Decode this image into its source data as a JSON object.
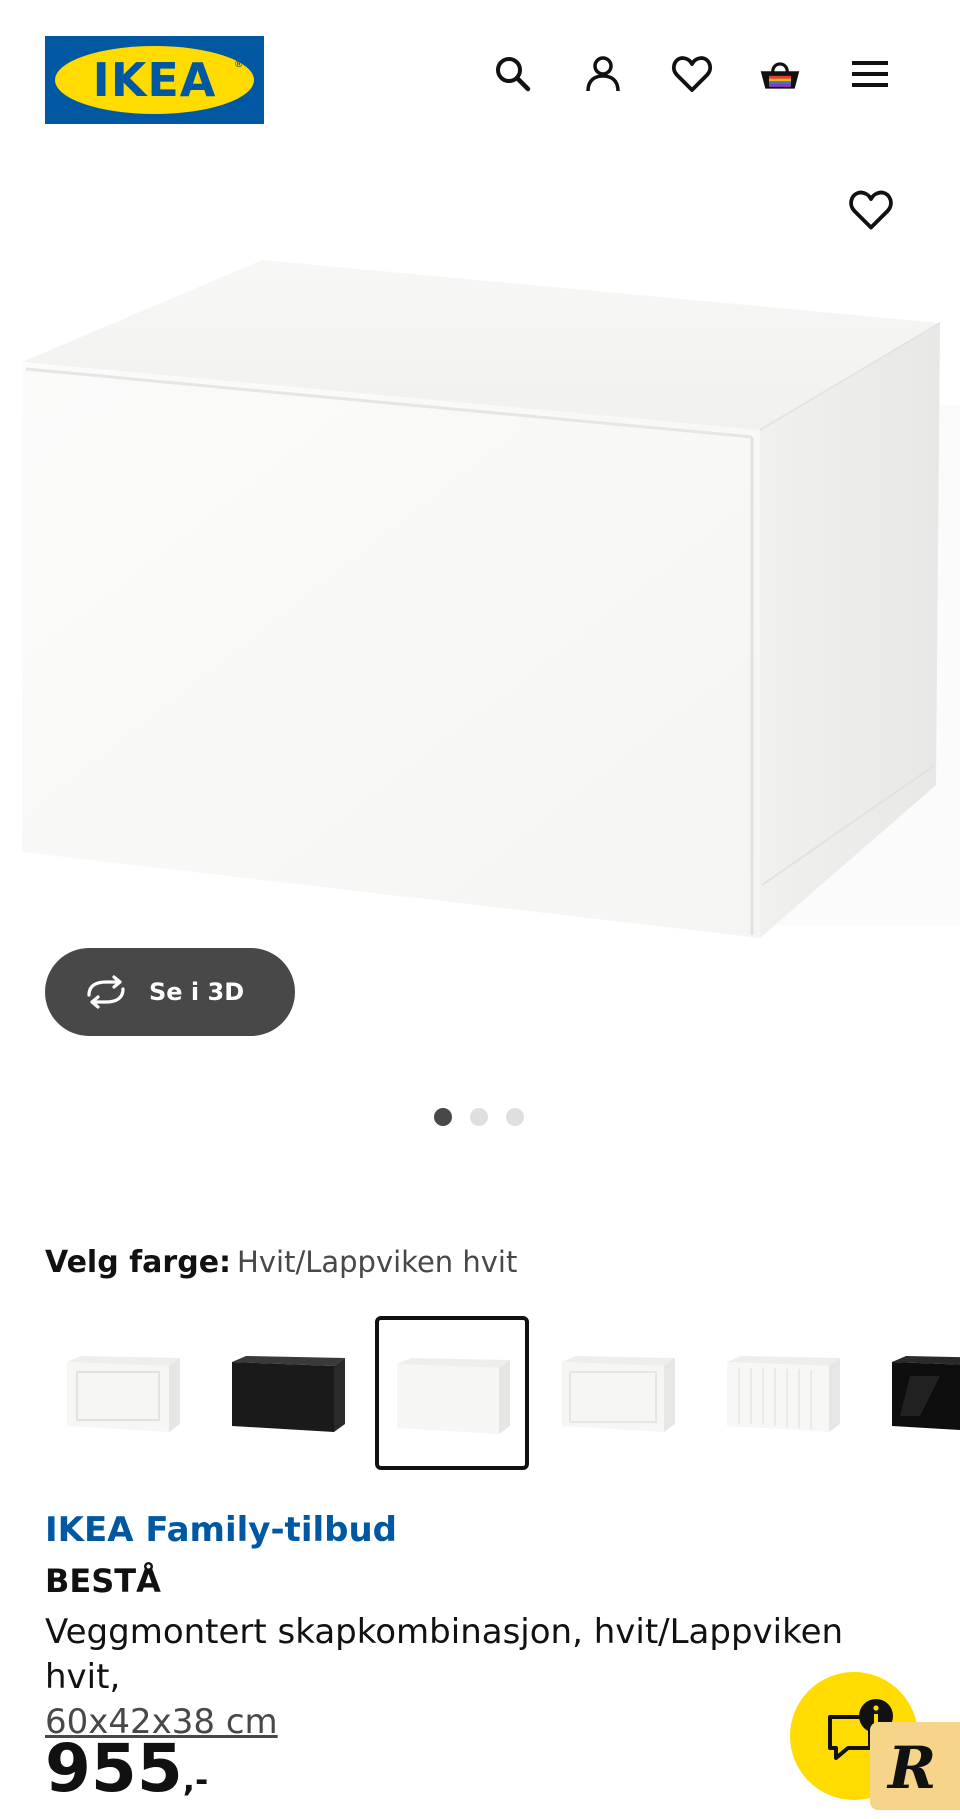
{
  "header": {
    "logo_text": "IKEA",
    "logo_mark": "®",
    "icons": [
      "search-icon",
      "user-icon",
      "heart-icon",
      "basket-icon",
      "menu-icon"
    ]
  },
  "hero": {
    "favorite_icon": "heart-icon",
    "view_3d_label": "Se i 3D",
    "carousel": {
      "total": 3,
      "active": 1
    }
  },
  "color_picker": {
    "label": "Velg farge:",
    "value": "Hvit/Lappviken hvit",
    "selected_index": 3
  },
  "product": {
    "badge": "IKEA Family-tilbud",
    "name": "BESTÅ",
    "description": "Veggmontert skapkombinasjon, hvit/Lappviken hvit,",
    "dimensions": "60x42x38 cm",
    "price": "955",
    "price_suffix": ",-"
  },
  "floating": {
    "chat_icon": "chat-info-icon",
    "badge_letter": "R"
  },
  "colors": {
    "ikea_blue": "#0058a3",
    "ikea_yellow": "#ffdb00",
    "dark_button": "#484848"
  }
}
